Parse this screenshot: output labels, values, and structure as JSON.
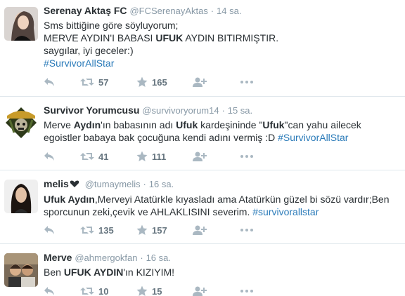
{
  "tweets": [
    {
      "fullname": "Serenay Aktaş FC",
      "username": "@FCSerenayAktas",
      "sep": "·",
      "time": "14 sa.",
      "lines": [
        [
          {
            "t": "Sms bittiğine göre söyluyorum;"
          }
        ],
        [
          {
            "t": "MERVE AYDIN'I BABASI "
          },
          {
            "t": "UFUK",
            "b": true
          },
          {
            "t": " AYDIN BITIRMIŞTIR."
          }
        ],
        [
          {
            "t": "saygılar, iyi geceler:)"
          }
        ],
        [
          {
            "t": "#SurvivorAllStar",
            "h": true
          }
        ]
      ],
      "retweets": "57",
      "likes": "165"
    },
    {
      "fullname": "Survivor Yorumcusu",
      "username": "@survivoryorum14",
      "sep": "·",
      "time": "15 sa.",
      "lines": [
        [
          {
            "t": "Merve "
          },
          {
            "t": "Aydın",
            "b": true
          },
          {
            "t": "'ın babasının adı "
          },
          {
            "t": "Ufuk",
            "b": true
          },
          {
            "t": " kardeşininde \""
          },
          {
            "t": "Ufuk",
            "b": true
          },
          {
            "t": "\"can yahu ailecek"
          }
        ],
        [
          {
            "t": "egoistler babaya bak çocuğuna kendi adını vermiş :D "
          },
          {
            "t": "#SurvivorAllStar",
            "h": true
          }
        ]
      ],
      "retweets": "41",
      "likes": "111"
    },
    {
      "fullname": "melis",
      "username": "@tumaymelis",
      "sep": "·",
      "time": "16 sa.",
      "lines": [
        [
          {
            "t": "Ufuk Aydın",
            "b": true
          },
          {
            "t": ",Merveyi Atatürkle kıyasladı ama Atatürkün güzel bi sözü vardır;Ben"
          }
        ],
        [
          {
            "t": "sporcunun zeki,çevik ve AHLAKLISINI severim. "
          },
          {
            "t": "#survivorallstar",
            "h": true
          }
        ]
      ],
      "retweets": "135",
      "likes": "157"
    },
    {
      "fullname": "Merve",
      "username": "@ahmergokfan",
      "sep": "·",
      "time": "16 sa.",
      "lines": [
        [
          {
            "t": "Ben "
          },
          {
            "t": "UFUK AYDIN",
            "b": true
          },
          {
            "t": "'ın KIZIYIM!"
          }
        ]
      ],
      "retweets": "10",
      "likes": "15"
    }
  ],
  "colors": {
    "text": "#292f33",
    "muted": "#8899a6",
    "hashtag": "#2b7bb9",
    "icon": "#aab8c2",
    "divider": "#e1e8ed"
  },
  "icons": [
    "reply-icon",
    "retweet-icon",
    "like-icon",
    "follow-icon",
    "more-icon",
    "heart-badge-icon"
  ]
}
